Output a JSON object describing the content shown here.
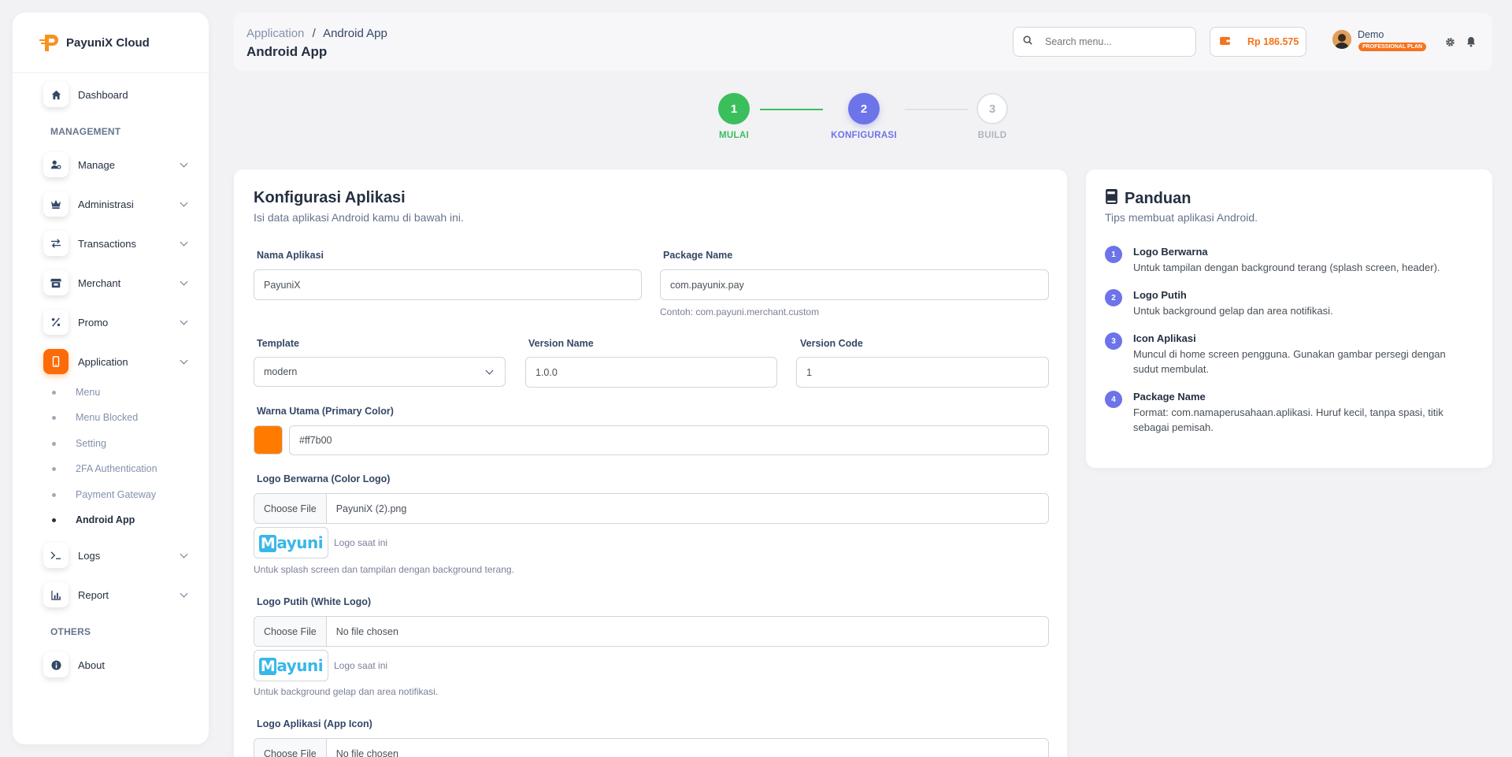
{
  "brand": {
    "name": "PayuniX Cloud"
  },
  "sidebar": {
    "dashboard": "Dashboard",
    "management_title": "MANAGEMENT",
    "manage": "Manage",
    "administrasi": "Administrasi",
    "transactions": "Transactions",
    "merchant": "Merchant",
    "promo": "Promo",
    "application": "Application",
    "application_sub": [
      "Menu",
      "Menu Blocked",
      "Setting",
      "2FA Authentication",
      "Payment Gateway",
      "Android App"
    ],
    "logs": "Logs",
    "report": "Report",
    "others_title": "OTHERS",
    "about": "About"
  },
  "header": {
    "breadcrumb_parent": "Application",
    "breadcrumb_sep": "/",
    "breadcrumb_current": "Android App",
    "title": "Android App",
    "search_placeholder": "Search menu...",
    "balance": "Rp 186.575",
    "user_name": "Demo",
    "plan": "PROFESSIONAL PLAN"
  },
  "stepper": [
    {
      "num": "1",
      "label": "MULAI",
      "state": "done"
    },
    {
      "num": "2",
      "label": "KONFIGURASI",
      "state": "active"
    },
    {
      "num": "3",
      "label": "BUILD",
      "state": "pending"
    }
  ],
  "form": {
    "title": "Konfigurasi Aplikasi",
    "subtitle": "Isi data aplikasi Android kamu di bawah ini.",
    "app_name_label": "Nama Aplikasi",
    "app_name_value": "PayuniX",
    "package_label": "Package Name",
    "package_value": "com.payunix.pay",
    "package_help": "Contoh: com.payuni.merchant.custom",
    "template_label": "Template",
    "template_value": "modern",
    "version_name_label": "Version Name",
    "version_name_value": "1.0.0",
    "version_code_label": "Version Code",
    "version_code_value": "1",
    "primary_color_label": "Warna Utama (Primary Color)",
    "primary_color_value": "#ff7b00",
    "choose_file": "Choose File",
    "color_logo_label": "Logo Berwarna (Color Logo)",
    "color_logo_file": "PayuniX (2).png",
    "current_logo_caption": "Logo saat ini",
    "color_logo_help": "Untuk splash screen dan tampilan dengan background terang.",
    "white_logo_label": "Logo Putih (White Logo)",
    "white_logo_file": "No file chosen",
    "white_logo_help": "Untuk background gelap dan area notifikasi.",
    "app_icon_label": "Logo Aplikasi (App Icon)",
    "app_icon_file": "No file chosen",
    "logo_text": "ayuni",
    "logo_m": "M"
  },
  "guide": {
    "title": "Panduan",
    "subtitle": "Tips membuat aplikasi Android.",
    "items": [
      {
        "num": "1",
        "title": "Logo Berwarna",
        "desc": "Untuk tampilan dengan background terang (splash screen, header)."
      },
      {
        "num": "2",
        "title": "Logo Putih",
        "desc": "Untuk background gelap dan area notifikasi."
      },
      {
        "num": "3",
        "title": "Icon Aplikasi",
        "desc": "Muncul di home screen pengguna. Gunakan gambar persegi dengan sudut membulat."
      },
      {
        "num": "4",
        "title": "Package Name",
        "desc": "Format: com.namaperusahaan.aplikasi. Huruf kecil, tanpa spasi, titik sebagai pemisah."
      }
    ]
  },
  "colors": {
    "accent": "#fb6b0a",
    "primary": "#ff7b00",
    "step_done": "#3bbf5c",
    "step_active": "#6d73e8"
  }
}
